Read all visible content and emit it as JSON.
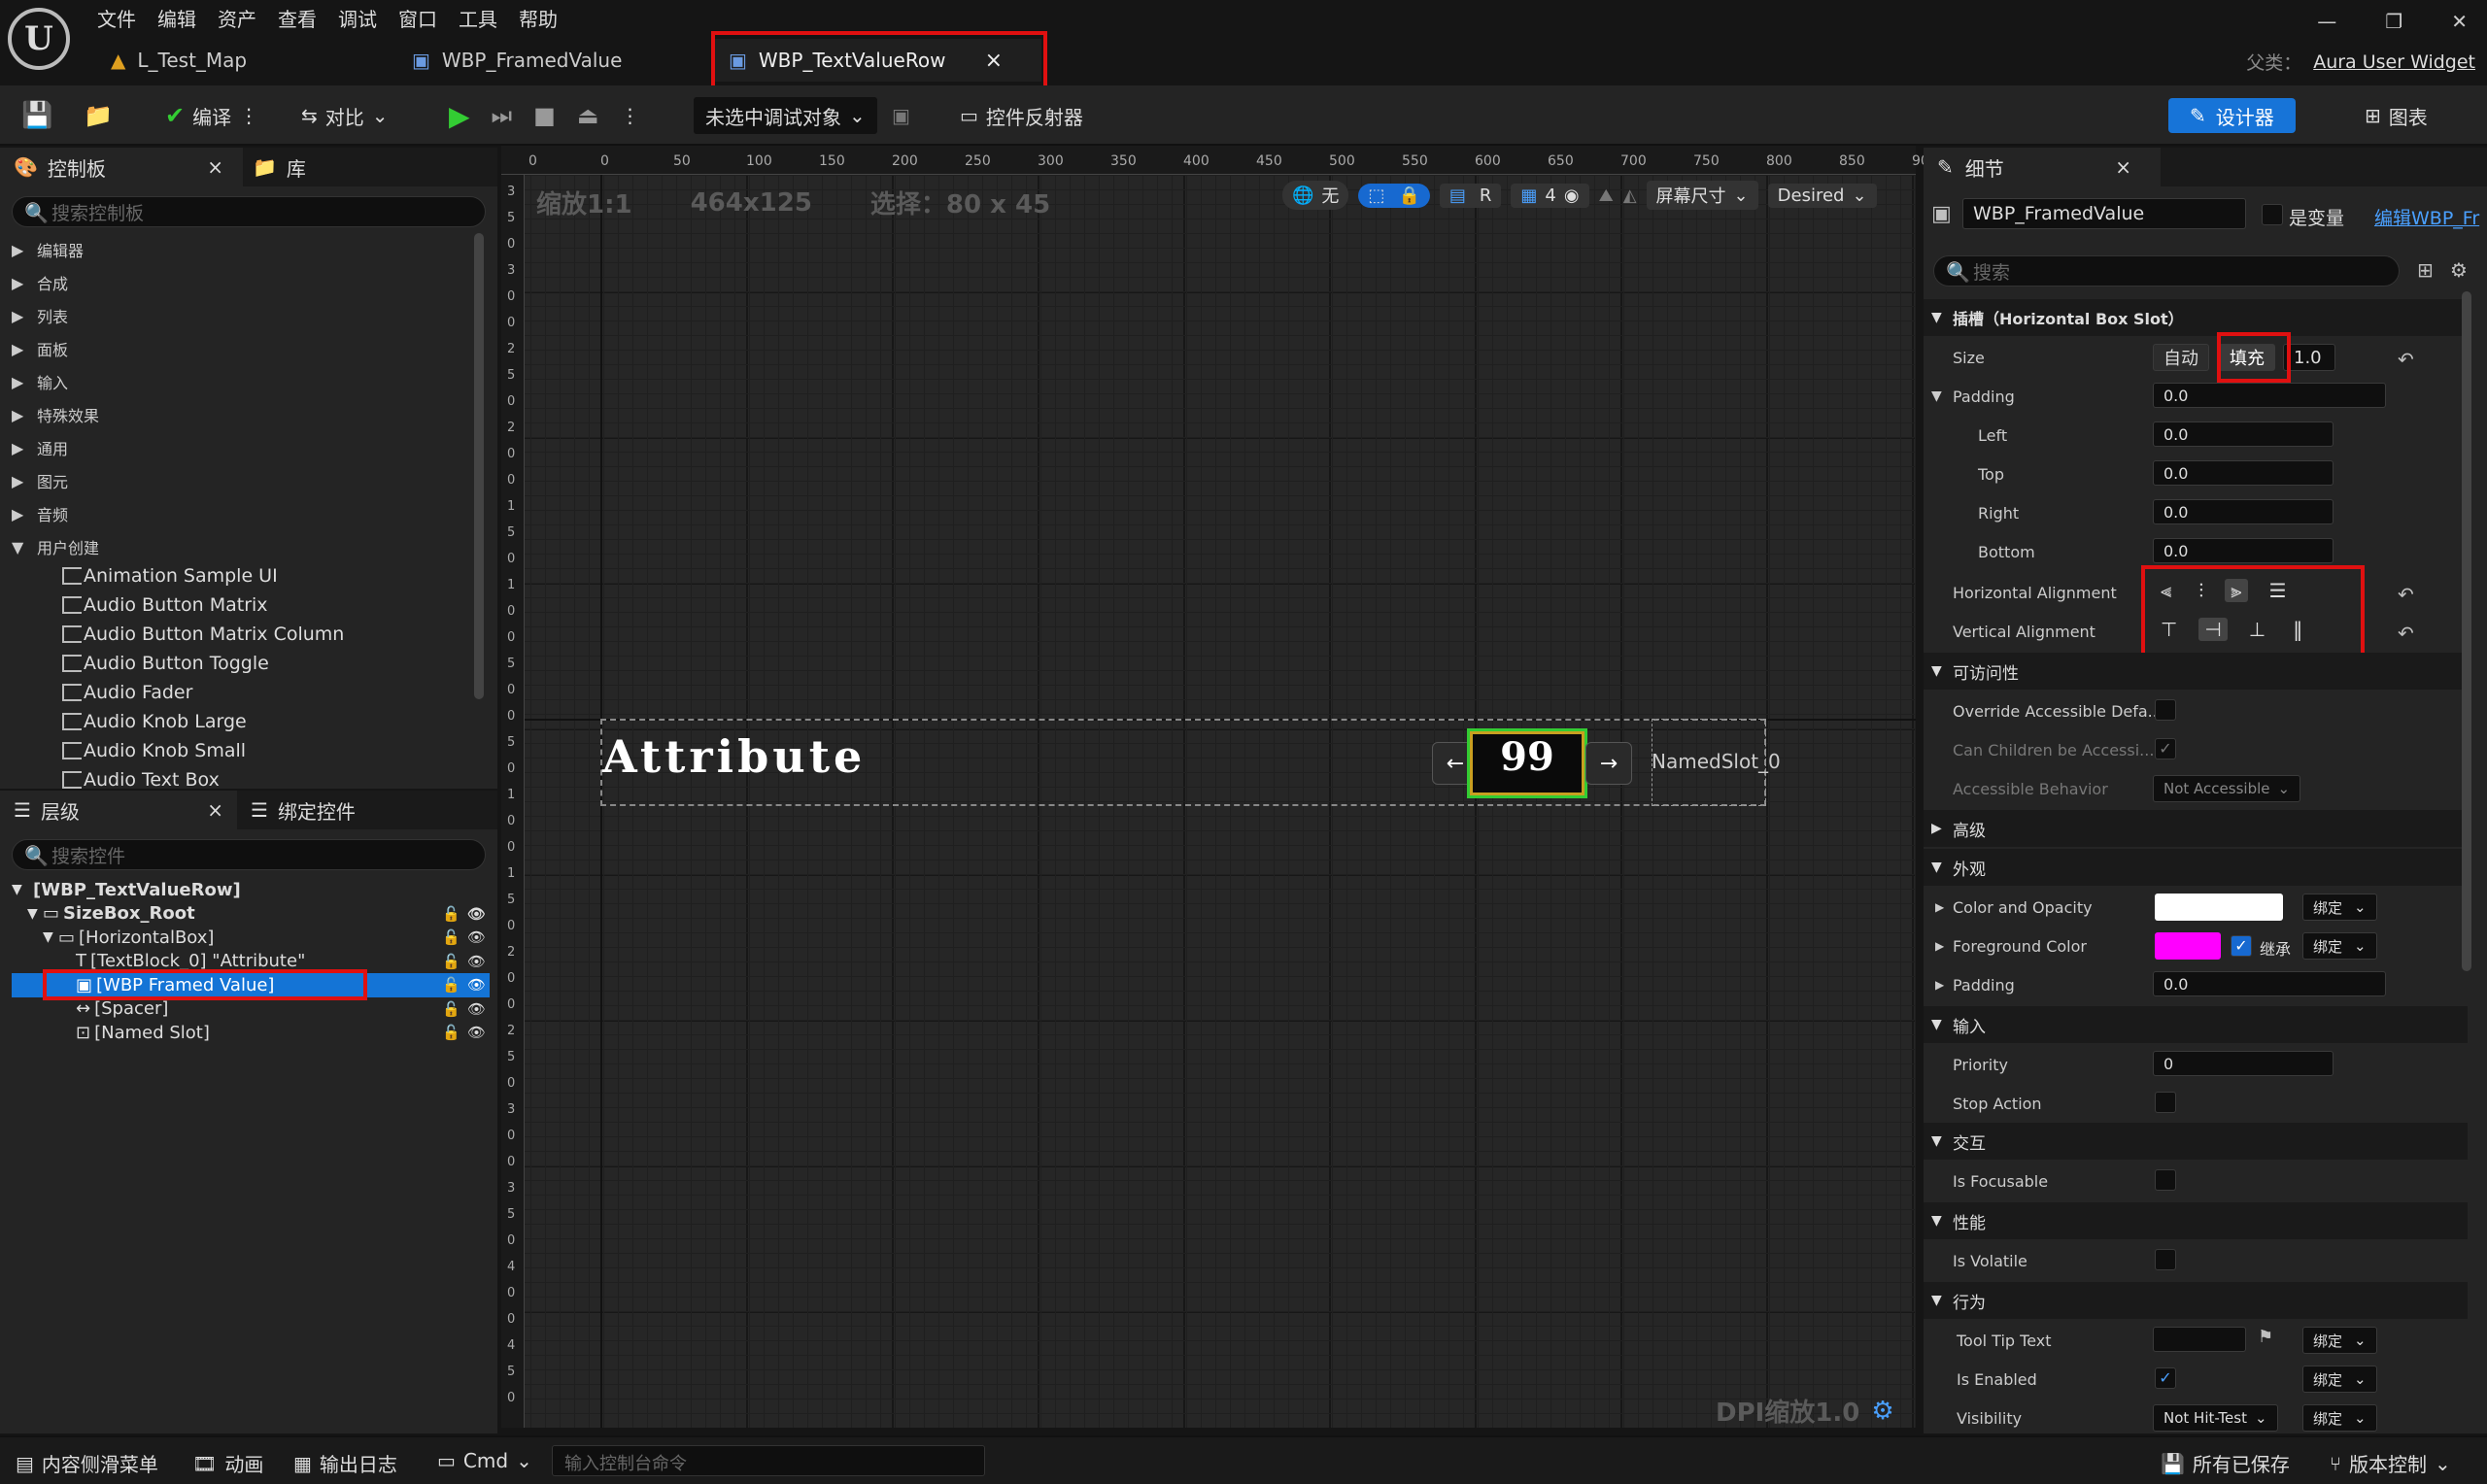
{
  "menu": [
    "文件",
    "编辑",
    "资产",
    "查看",
    "调试",
    "窗口",
    "工具",
    "帮助"
  ],
  "tabs": [
    {
      "label": "L_Test_Map"
    },
    {
      "label": "WBP_FramedValue"
    },
    {
      "label": "WBP_TextValueRow",
      "close": "×"
    }
  ],
  "parent_class": {
    "label": "父类：",
    "value": "Aura User Widget"
  },
  "window_controls": [
    "—",
    "❐",
    "✕"
  ],
  "toolbar": {
    "compile": "编译",
    "diff": "对比",
    "debug_target": "未选中调试对象",
    "reflector": "控件反射器",
    "designer": "设计器",
    "graph": "图表"
  },
  "palette": {
    "tab": "控制板",
    "tab_close": "×",
    "library": "库",
    "search_placeholder": "搜索控制板",
    "categories": [
      "编辑器",
      "合成",
      "列表",
      "面板",
      "输入",
      "特殊效果",
      "通用",
      "图元",
      "音频",
      "用户创建"
    ],
    "widgets": [
      "Animation Sample UI",
      "Audio Button Matrix",
      "Audio Button Matrix Column",
      "Audio Button Toggle",
      "Audio Fader",
      "Audio Knob Large",
      "Audio Knob Small",
      "Audio Text Box"
    ]
  },
  "hierarchy": {
    "tab": "层级",
    "tab_close": "×",
    "bind_tab": "绑定控件",
    "search_placeholder": "搜索控件",
    "items": [
      {
        "label": "[WBP_TextValueRow]"
      },
      {
        "label": "SizeBox_Root"
      },
      {
        "label": "[HorizontalBox]"
      },
      {
        "label": "[TextBlock_0] \"Attribute\""
      },
      {
        "label": "[WBP Framed Value]"
      },
      {
        "label": "[Spacer]"
      },
      {
        "label": "[Named Slot]"
      }
    ]
  },
  "canvas": {
    "zoom": "缩放1:1",
    "size": "464x125",
    "selection": "选择：80 x 45",
    "ruler": [
      "0",
      "0",
      "50",
      "100",
      "150",
      "200",
      "250",
      "300",
      "350",
      "400",
      "450",
      "500",
      "550",
      "600",
      "650",
      "700",
      "750",
      "800",
      "850",
      "90"
    ],
    "left_ruler": [
      "3",
      "5",
      "0",
      "3",
      "0",
      "0",
      "2",
      "5",
      "0",
      "2",
      "0",
      "0",
      "1",
      "5",
      "0",
      "1",
      "0",
      "0",
      "5",
      "0",
      "0",
      "5",
      "0",
      "1",
      "0",
      "0",
      "1",
      "5",
      "0",
      "2",
      "0",
      "0",
      "2",
      "5",
      "0",
      "3",
      "0",
      "0",
      "3",
      "5",
      "0",
      "4",
      "0",
      "0",
      "4",
      "5",
      "0"
    ],
    "none": "无",
    "r": "R",
    "grid_count": "4",
    "screen_size": "屏幕尺寸",
    "desired": "Desired",
    "attribute_text": "Attribute",
    "value_text": "99",
    "arrow_left": "←",
    "arrow_right": "→",
    "named_slot": "NamedSlot_0",
    "dpi": "DPI缩放1.0"
  },
  "details": {
    "tab": "细节",
    "tab_close": "×",
    "widget_name": "WBP_FramedValue",
    "is_variable": "是变量",
    "edit_link": "编辑WBP_Fr",
    "search_placeholder": "搜索",
    "slot_section": "插槽（Horizontal Box Slot）",
    "size_label": "Size",
    "size_auto": "自动",
    "size_fill": "填充",
    "size_value": "1.0",
    "padding_label": "Padding",
    "padding_value": "0.0",
    "left_label": "Left",
    "left_value": "0.0",
    "top_label": "Top",
    "top_value": "0.0",
    "right_label": "Right",
    "right_value": "0.0",
    "bottom_label": "Bottom",
    "bottom_value": "0.0",
    "halign_label": "Horizontal Alignment",
    "valign_label": "Vertical Alignment",
    "access_section": "可访问性",
    "override_access": "Override Accessible Defa...",
    "children_access": "Can Children be Accessi...",
    "access_behavior": "Accessible Behavior",
    "not_accessible": "Not Accessible",
    "advanced_section": "高级",
    "appearance_section": "外观",
    "color_opacity": "Color and Opacity",
    "foreground_color": "Foreground Color",
    "inherit": "继承",
    "bind": "绑定",
    "appearance_padding": "Padding",
    "appearance_padding_value": "0.0",
    "input_section": "输入",
    "priority": "Priority",
    "priority_value": "0",
    "stop_action": "Stop Action",
    "interaction_section": "交互",
    "is_focusable": "Is Focusable",
    "performance_section": "性能",
    "is_volatile": "Is Volatile",
    "behavior_section": "行为",
    "tooltip": "Tool Tip Text",
    "is_enabled": "Is Enabled",
    "visibility": "Visibility",
    "visibility_value": "Not Hit-Test",
    "colors": {
      "white": "#ffffff",
      "magenta": "#ff00ff"
    }
  },
  "statusbar": {
    "drawer": "内容侧滑菜单",
    "animation": "动画",
    "output_log": "输出日志",
    "cmd": "Cmd",
    "console_placeholder": "输入控制台命令",
    "all_saved": "所有已保存",
    "version_control": "版本控制"
  }
}
